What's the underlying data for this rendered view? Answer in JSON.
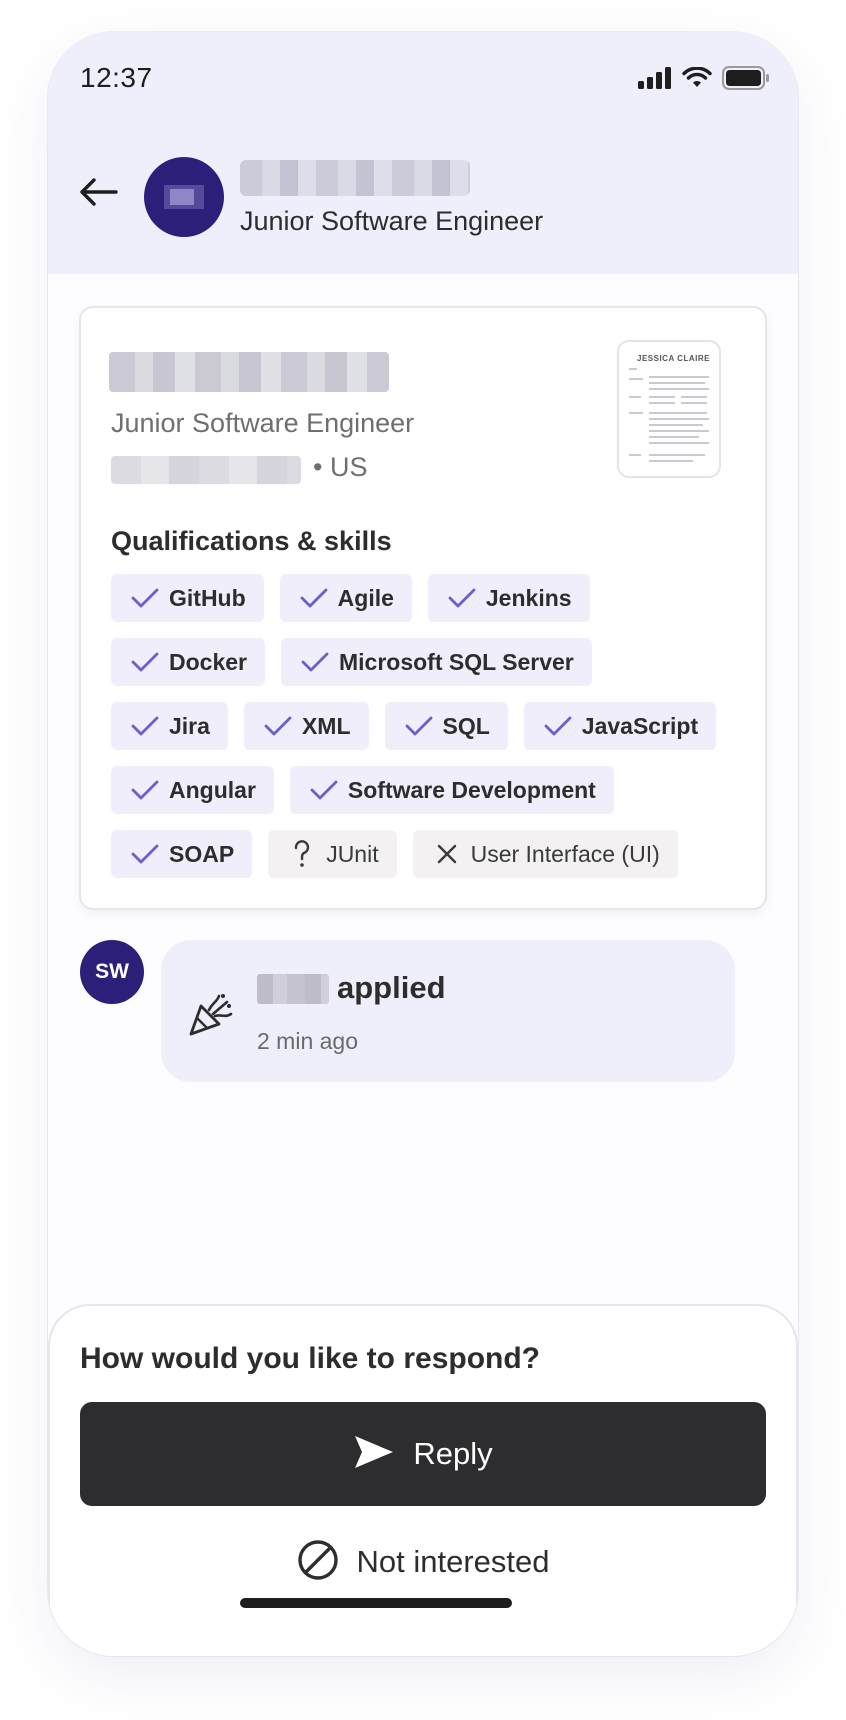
{
  "status_bar": {
    "time": "12:37"
  },
  "header": {
    "back_icon": "arrow-left-icon",
    "subtitle": "Junior Software Engineer"
  },
  "card": {
    "job_title": "Junior Software Engineer",
    "location_suffix": "• US",
    "resume_name": "JESSICA CLAIRE",
    "quals_heading": "Qualifications & skills",
    "skill_rows": [
      [
        {
          "label": "GitHub",
          "status": "match"
        },
        {
          "label": "Agile",
          "status": "match"
        },
        {
          "label": "Jenkins",
          "status": "match"
        }
      ],
      [
        {
          "label": "Docker",
          "status": "match"
        },
        {
          "label": "Microsoft SQL Server",
          "status": "match"
        }
      ],
      [
        {
          "label": "Jira",
          "status": "match"
        },
        {
          "label": "XML",
          "status": "match"
        },
        {
          "label": "SQL",
          "status": "match"
        },
        {
          "label": "JavaScript",
          "status": "match"
        }
      ],
      [
        {
          "label": "Angular",
          "status": "match"
        },
        {
          "label": "Software Development",
          "status": "match"
        }
      ],
      [
        {
          "label": "SOAP",
          "status": "match"
        },
        {
          "label": "JUnit",
          "status": "unknown"
        },
        {
          "label": "User Interface (UI)",
          "status": "missing"
        }
      ]
    ]
  },
  "activity": {
    "avatar_initials": "SW",
    "action": "applied",
    "time": "2 min ago"
  },
  "sheet": {
    "question": "How would you like to respond?",
    "reply_label": "Reply",
    "not_interested_label": "Not interested"
  },
  "colors": {
    "accent": "#6b5fcf",
    "brand_dark": "#2b1f7a",
    "chip_bg": "#efeefa",
    "header_bg": "#eeeffb",
    "button_dark": "#2d2d2f"
  }
}
